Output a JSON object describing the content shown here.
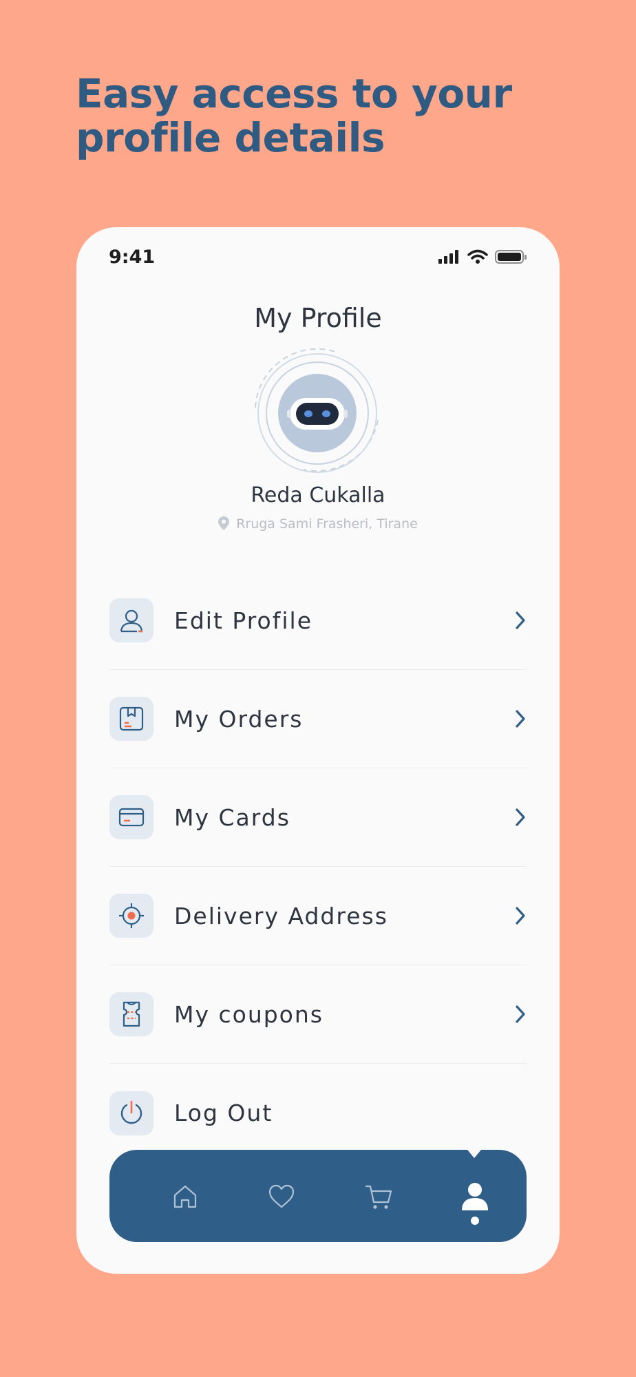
{
  "headline": {
    "line1": "Easy access to your",
    "line2": "profile details"
  },
  "status_bar": {
    "time": "9:41"
  },
  "page_title": "My Profile",
  "profile": {
    "name": "Reda Cukalla",
    "location": "Rruga Sami Frasheri, Tirane"
  },
  "menu": {
    "items": [
      {
        "label": "Edit Profile",
        "icon": "user-icon"
      },
      {
        "label": "My Orders",
        "icon": "box-icon"
      },
      {
        "label": "My Cards",
        "icon": "card-icon"
      },
      {
        "label": "Delivery Address",
        "icon": "target-icon"
      },
      {
        "label": "My coupons",
        "icon": "ticket-icon"
      },
      {
        "label": "Log Out",
        "icon": "power-icon"
      }
    ]
  },
  "bottom_nav": {
    "items": [
      "home-icon",
      "heart-icon",
      "cart-icon",
      "profile-icon"
    ],
    "active": "profile-icon"
  },
  "colors": {
    "background": "#FFA78B",
    "primary": "#2F5F88",
    "accent": "#F06A4C",
    "card": "#FAFAFA",
    "icon_bg": "#E3EAF1"
  }
}
